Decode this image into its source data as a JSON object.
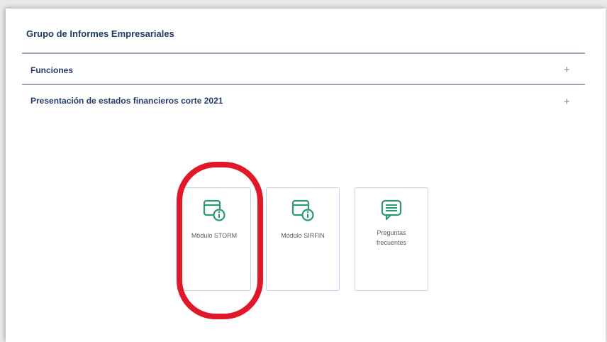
{
  "group_title": "Grupo de Informes Empresariales",
  "accordion": [
    {
      "label": "Funciones",
      "toggle": "+"
    },
    {
      "label": "Presentación de estados financieros corte 2021",
      "toggle": "+"
    }
  ],
  "cards": [
    {
      "label": "Módulo STORM",
      "icon": "browser-info-icon"
    },
    {
      "label": "Módulo SIRFIN",
      "icon": "browser-info-icon"
    },
    {
      "label_line1": "Preguntas",
      "label_line2": "frecuentes",
      "icon": "chat-bubble-icon"
    }
  ],
  "colors": {
    "icon_green": "#2b9a73",
    "heading_navy": "#233c66",
    "card_border": "#bcd3ea",
    "highlight_red": "#e1172a"
  }
}
